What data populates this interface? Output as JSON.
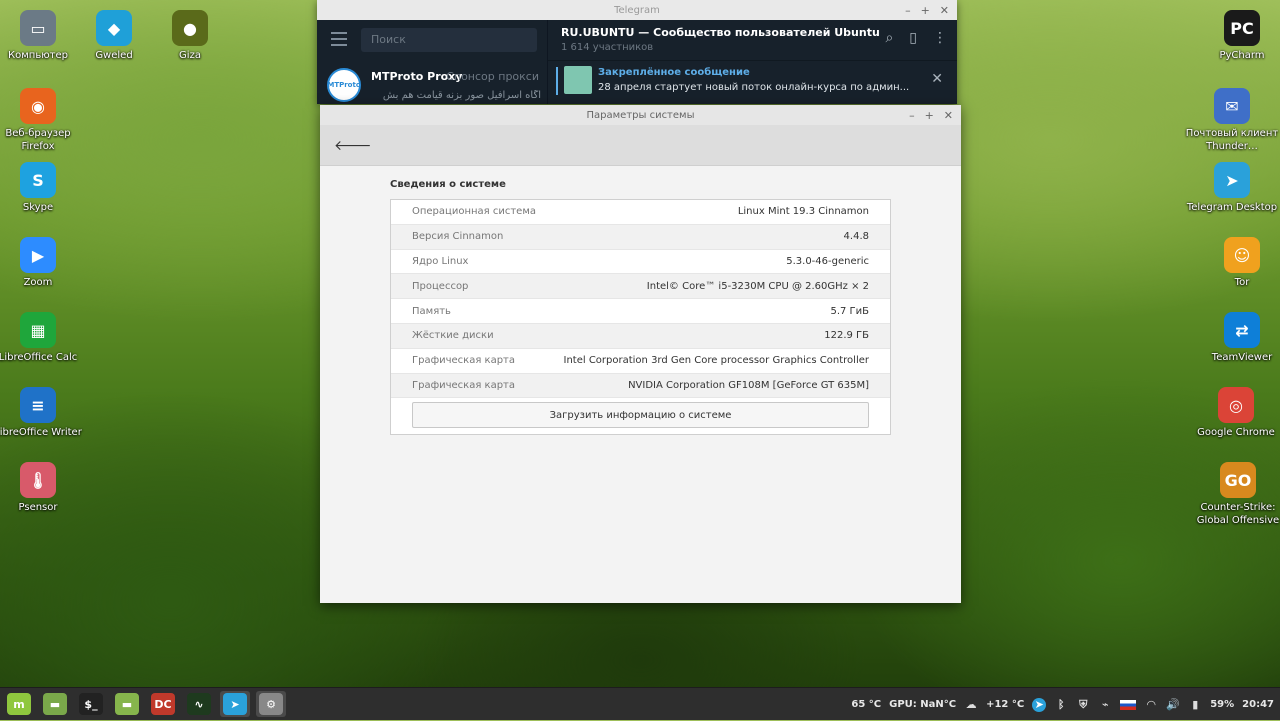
{
  "desktop": {
    "left_icons": [
      {
        "label": "Компьютер",
        "icon": "computer-icon",
        "glyph": "▭",
        "color": "#6b7a86"
      },
      {
        "label": "Gweled",
        "icon": "gem-icon",
        "glyph": "◆",
        "color": "#1fa0d8"
      },
      {
        "label": "Giza",
        "icon": "owl-icon",
        "glyph": "●",
        "color": "#5a6a1a"
      },
      {
        "label": "Веб-браузер Firefox",
        "icon": "firefox-icon",
        "glyph": "◉",
        "color": "#e8641e"
      },
      {
        "label": "Skype",
        "icon": "skype-icon",
        "glyph": "S",
        "color": "#1ea2e0"
      },
      {
        "label": "Zoom",
        "icon": "zoom-icon",
        "glyph": "▶",
        "color": "#2d8cff"
      },
      {
        "label": "LibreOffice Calc",
        "icon": "libreoffice-calc-icon",
        "glyph": "▦",
        "color": "#1fa63b"
      },
      {
        "label": "LibreOffice Writer",
        "icon": "libreoffice-writer-icon",
        "glyph": "≡",
        "color": "#1f72c8"
      },
      {
        "label": "Psensor",
        "icon": "thermometer-icon",
        "glyph": "🌡",
        "color": "#d85a6a"
      }
    ],
    "right_icons": [
      {
        "label": "PyCharm",
        "icon": "pycharm-icon",
        "glyph": "PC",
        "color": "#1a1a1a"
      },
      {
        "label": "Почтовый клиент Thunder…",
        "icon": "thunderbird-icon",
        "glyph": "✉",
        "color": "#3f6fc8"
      },
      {
        "label": "Telegram Desktop",
        "icon": "telegram-icon",
        "glyph": "➤",
        "color": "#2aa1da"
      },
      {
        "label": "Tor",
        "icon": "tor-smiley-icon",
        "glyph": "☺",
        "color": "#f0a11e"
      },
      {
        "label": "TeamViewer",
        "icon": "teamviewer-icon",
        "glyph": "⇄",
        "color": "#0e7fd8"
      },
      {
        "label": "Google Chrome",
        "icon": "chrome-icon",
        "glyph": "◎",
        "color": "#db4437"
      },
      {
        "label": "Counter-Strike: Global Offensive",
        "icon": "csgo-icon",
        "glyph": "GO",
        "color": "#d8891e"
      }
    ]
  },
  "telegram": {
    "window_title": "Telegram",
    "search_placeholder": "Поиск",
    "chat": {
      "name": "MTProto Proxy",
      "sponsor": "Спонсор прокси",
      "preview": "آگاه اسرافیل صور بزنه قیامت هم بش",
      "avatar_text": "MTProto"
    },
    "channel": {
      "title": "RU.UBUNTU — Сообщество пользователей Ubuntu",
      "subtitle": "1 614 участников"
    },
    "pinned": {
      "title": "Закреплённое сообщение",
      "text": "28 апреля стартует новый поток онлайн-курса по админ..."
    }
  },
  "settings": {
    "window_title": "Параметры системы",
    "section_title": "Сведения о системе",
    "rows": [
      {
        "key": "Операционная система",
        "value": "Linux Mint 19.3 Cinnamon"
      },
      {
        "key": "Версия Cinnamon",
        "value": "4.4.8"
      },
      {
        "key": "Ядро Linux",
        "value": "5.3.0-46-generic"
      },
      {
        "key": "Процессор",
        "value": "Intel© Core™ i5-3230M CPU @ 2.60GHz × 2"
      },
      {
        "key": "Память",
        "value": "5.7 ГиБ"
      },
      {
        "key": "Жёсткие диски",
        "value": "122.9 ГБ"
      },
      {
        "key": "Графическая карта",
        "value": "Intel Corporation 3rd Gen Core processor Graphics Controller"
      },
      {
        "key": "Графическая карта",
        "value": "NVIDIA Corporation GF108M [GeForce GT 635M]"
      }
    ],
    "upload_button": "Загрузить информацию о системе"
  },
  "taskbar": {
    "apps": [
      {
        "name": "mint-menu-icon",
        "glyph": "m",
        "color": "#8fc73e"
      },
      {
        "name": "show-desktop-icon",
        "glyph": "▬",
        "color": "#7aa84a"
      },
      {
        "name": "terminal-icon",
        "glyph": "$_",
        "color": "#222"
      },
      {
        "name": "files-icon",
        "glyph": "▬",
        "color": "#86b54c"
      },
      {
        "name": "double-commander-icon",
        "glyph": "DC",
        "color": "#c0392b"
      },
      {
        "name": "system-monitor-icon",
        "glyph": "∿",
        "color": "#1e3a1e"
      },
      {
        "name": "telegram-taskbar-icon",
        "glyph": "➤",
        "color": "#2aa1da"
      },
      {
        "name": "system-settings-icon",
        "glyph": "⚙",
        "color": "#888"
      }
    ],
    "cpu_temp": "65 °C",
    "gpu_temp": "GPU: NaN°C",
    "weather": "+12 °C",
    "battery": "59%",
    "clock": "20:47"
  }
}
